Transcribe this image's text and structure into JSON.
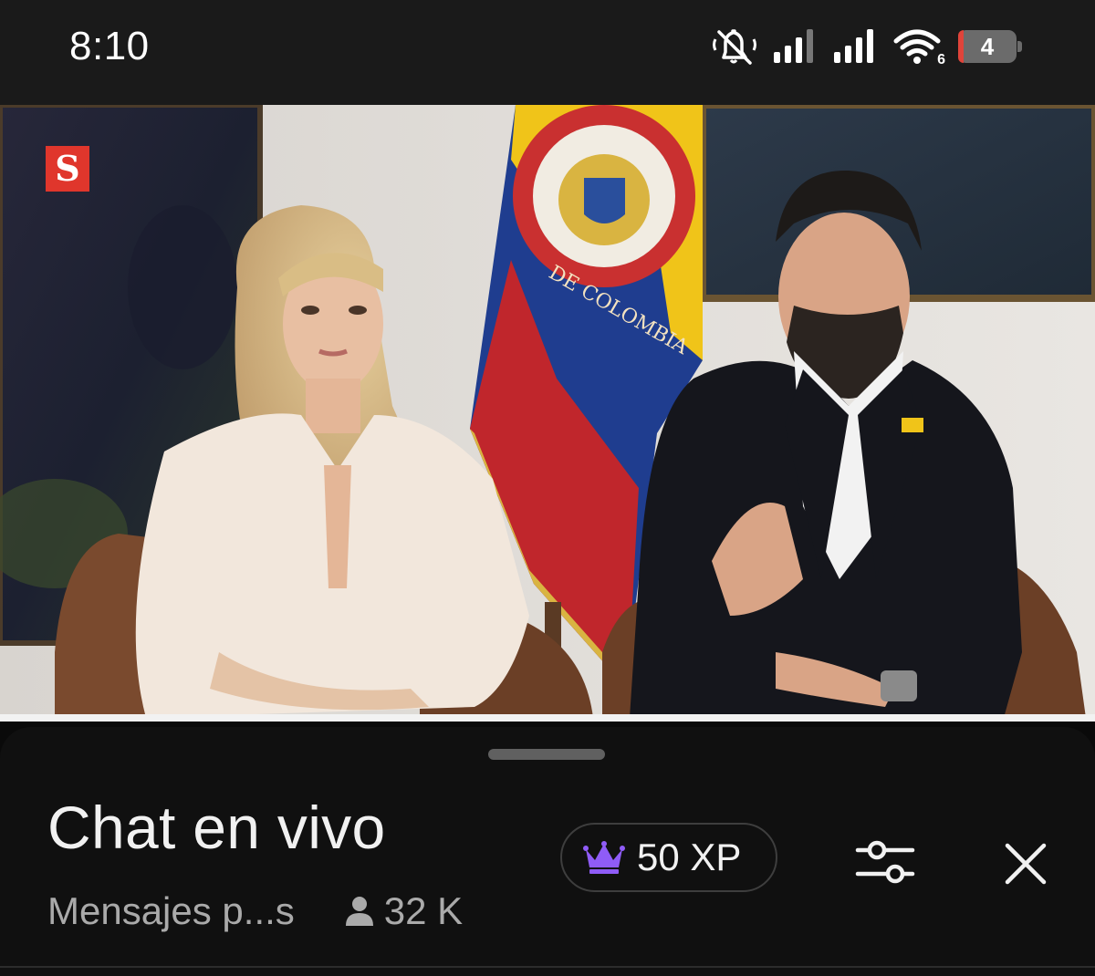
{
  "status_bar": {
    "time": "8:10",
    "icons": [
      "muted-bell-icon",
      "signal-icon",
      "signal-icon",
      "wifi-6-icon",
      "battery-icon"
    ],
    "wifi_badge": "6",
    "battery_level": "4",
    "battery_color": "#e0443a"
  },
  "video": {
    "channel_logo_text": "S",
    "channel_logo_color": "#e0362c",
    "flag_seal_text": "DE COLOMBIA"
  },
  "chat_sheet": {
    "title": "Chat en vivo",
    "mode_label": "Mensajes p...s",
    "viewer_count": "32 K",
    "xp_label": "50 XP",
    "xp_icon": "crown-icon",
    "xp_icon_color": "#8f5cf7",
    "filter_icon": "sliders-icon",
    "close_icon": "close-icon"
  }
}
